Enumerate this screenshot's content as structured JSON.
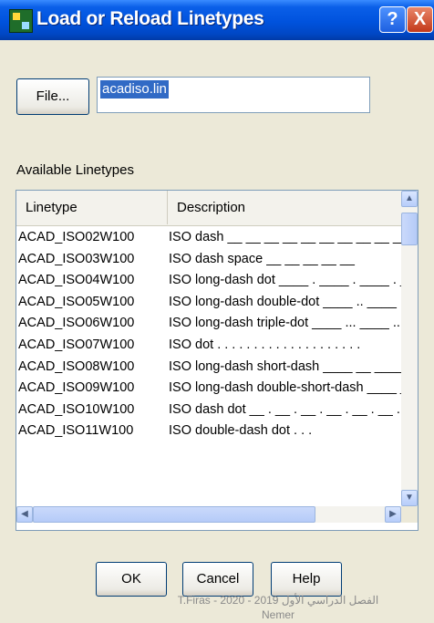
{
  "window": {
    "title": "Load or Reload Linetypes",
    "help_glyph": "?",
    "close_glyph": "X",
    "icon": "app-icon"
  },
  "file_button": {
    "label": "File..."
  },
  "file_field": {
    "value": "acadiso.lin"
  },
  "available_label": "Available Linetypes",
  "table": {
    "columns": [
      "Linetype",
      "Description"
    ],
    "rows": [
      {
        "name": "ACAD_ISO02W100",
        "desc": "ISO dash __ __ __ __ __ __ __ __ __ __"
      },
      {
        "name": "ACAD_ISO03W100",
        "desc": "ISO dash space __    __    __    __    __"
      },
      {
        "name": "ACAD_ISO04W100",
        "desc": "ISO long-dash dot ____ . ____ . ____ . __"
      },
      {
        "name": "ACAD_ISO05W100",
        "desc": "ISO long-dash double-dot ____ .. ____ .."
      },
      {
        "name": "ACAD_ISO06W100",
        "desc": "ISO long-dash triple-dot ____ ... ____ ..."
      },
      {
        "name": "ACAD_ISO07W100",
        "desc": "ISO dot . . . . . . . . . . . . . . . . . . . ."
      },
      {
        "name": "ACAD_ISO08W100",
        "desc": "ISO long-dash short-dash ____ __ ____"
      },
      {
        "name": "ACAD_ISO09W100",
        "desc": "ISO long-dash double-short-dash ____ __ __"
      },
      {
        "name": "ACAD_ISO10W100",
        "desc": "ISO dash dot __ . __ . __ . __ . __ . __ ."
      },
      {
        "name": "ACAD_ISO11W100",
        "desc": "ISO double-dash dot       .        .        ."
      }
    ]
  },
  "scroll": {
    "up": "▲",
    "down": "▼",
    "left": "◀",
    "right": "▶"
  },
  "buttons": {
    "ok": "OK",
    "cancel": "Cancel",
    "help": "Help"
  },
  "footer": {
    "line1": "T.Firas  -  2020 - 2019 الفصل الدراسي الأول",
    "line2": "Nemer"
  },
  "colors": {
    "titlebar": "#0052dd",
    "selection": "#316ac5",
    "dialog_bg": "#ece9d8"
  }
}
